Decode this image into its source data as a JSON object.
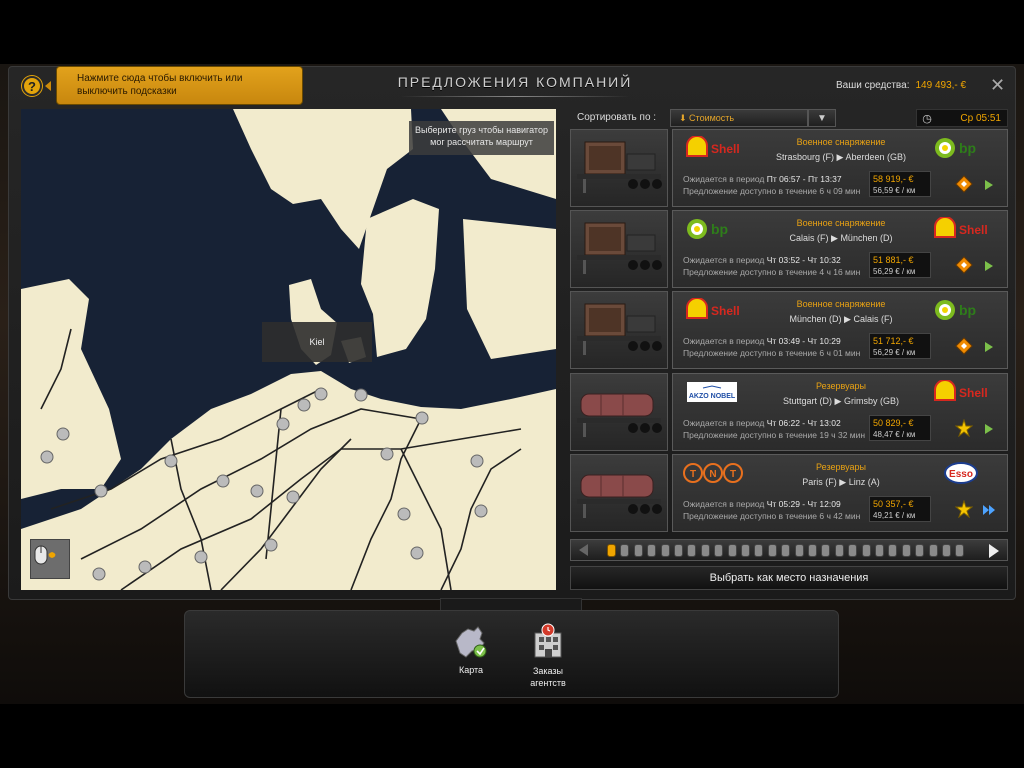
{
  "header": {
    "help_icon": "?",
    "hint": "Нажмите сюда чтобы включить или выключить подсказки",
    "title": "ПРЕДЛОЖЕНИЯ КОМПАНИЙ",
    "funds_label": "Ваши средства:",
    "funds_value": "149 493,- €",
    "close": "✕"
  },
  "map": {
    "tip": "Выберите груз чтобы навигатор мог рассчитать маршрут",
    "city_label": "Kiel",
    "land_color": "#f2ebcd",
    "sea_color": "#172235"
  },
  "sort": {
    "label": "Сортировать по :",
    "value": "Стоимость",
    "dropdown_icon": "chevron-down-icon"
  },
  "clock": {
    "time": "Ср 05:51"
  },
  "offers": [
    {
      "cargo": "Военное снаряжение",
      "route": "Strasbourg (F) ▶ Aberdeen (GB)",
      "from_company": "Shell",
      "to_company": "bp",
      "period_label": "Ожидается в период",
      "period": "Пт 06:57 - Пт 13:37",
      "available_label": "Предложение доступно в течение",
      "available": "6 ч 09 мин",
      "price": "58 919,- €",
      "per_km": "56,59 € / км",
      "marker": "diamond",
      "trailer": "container"
    },
    {
      "cargo": "Военное снаряжение",
      "route": "Calais (F) ▶ München (D)",
      "from_company": "bp",
      "to_company": "Shell",
      "period_label": "Ожидается в период",
      "period": "Чт 03:52 - Чт 10:32",
      "available_label": "Предложение доступно в течение",
      "available": "4 ч 16 мин",
      "price": "51 881,- €",
      "per_km": "56,29 € / км",
      "marker": "diamond",
      "trailer": "container"
    },
    {
      "cargo": "Военное снаряжение",
      "route": "München (D) ▶ Calais (F)",
      "from_company": "Shell",
      "to_company": "bp",
      "period_label": "Ожидается в период",
      "period": "Чт 03:49 - Чт 10:29",
      "available_label": "Предложение доступно в течение",
      "available": "6 ч 01 мин",
      "price": "51 712,- €",
      "per_km": "56,29 € / км",
      "marker": "diamond",
      "trailer": "container"
    },
    {
      "cargo": "Резервуары",
      "route": "Stuttgart (D) ▶ Grimsby (GB)",
      "from_company": "AKZO NOBEL",
      "to_company": "Shell",
      "period_label": "Ожидается в период",
      "period": "Чт 06:22 - Чт 13:02",
      "available_label": "Предложение доступно в течение",
      "available": "19 ч 32 мин",
      "price": "50 829,- €",
      "per_km": "48,47 € / км",
      "marker": "star",
      "trailer": "tank"
    },
    {
      "cargo": "Резервуары",
      "route": "Paris (F) ▶ Linz (A)",
      "from_company": "TNT",
      "to_company": "ESSO",
      "period_label": "Ожидается в период",
      "period": "Чт 05:29 - Чт 12:09",
      "available_label": "Предложение доступно в течение",
      "available": "6 ч 42 мин",
      "price": "50 357,- €",
      "per_km": "49,21 € / км",
      "marker": "star",
      "trailer": "tank"
    }
  ],
  "pager": {
    "pages": 27,
    "active": 1
  },
  "select_destination": "Выбрать как место назначения",
  "dock": {
    "map_label": "Карта",
    "agency_label_1": "Заказы",
    "agency_label_2": "агентств"
  }
}
